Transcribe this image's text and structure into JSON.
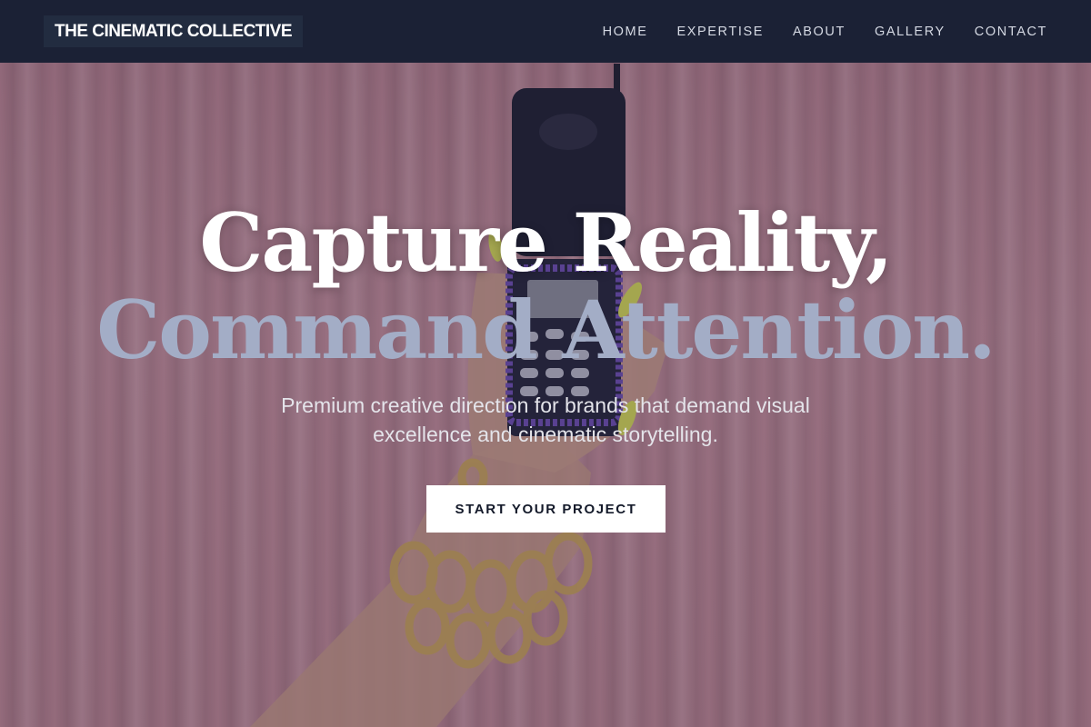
{
  "header": {
    "brand": "THE CINEMATIC COLLECTIVE",
    "nav": [
      {
        "label": "HOME"
      },
      {
        "label": "EXPERTISE"
      },
      {
        "label": "ABOUT"
      },
      {
        "label": "GALLERY"
      },
      {
        "label": "CONTACT"
      }
    ]
  },
  "hero": {
    "headline_line1": "Capture Reality,",
    "headline_line2": "Command Attention.",
    "subtitle": "Premium creative direction for brands that demand visual excellence and cinematic storytelling.",
    "cta_label": "START YOUR PROJECT",
    "background_image": "hand-holding-flip-phone-against-pink-curtain"
  },
  "colors": {
    "nav_background": "#1b2135",
    "headline_primary": "#ffffff",
    "headline_accent": "#a3adc6",
    "cta_background": "#ffffff",
    "cta_text": "#141a2a"
  }
}
